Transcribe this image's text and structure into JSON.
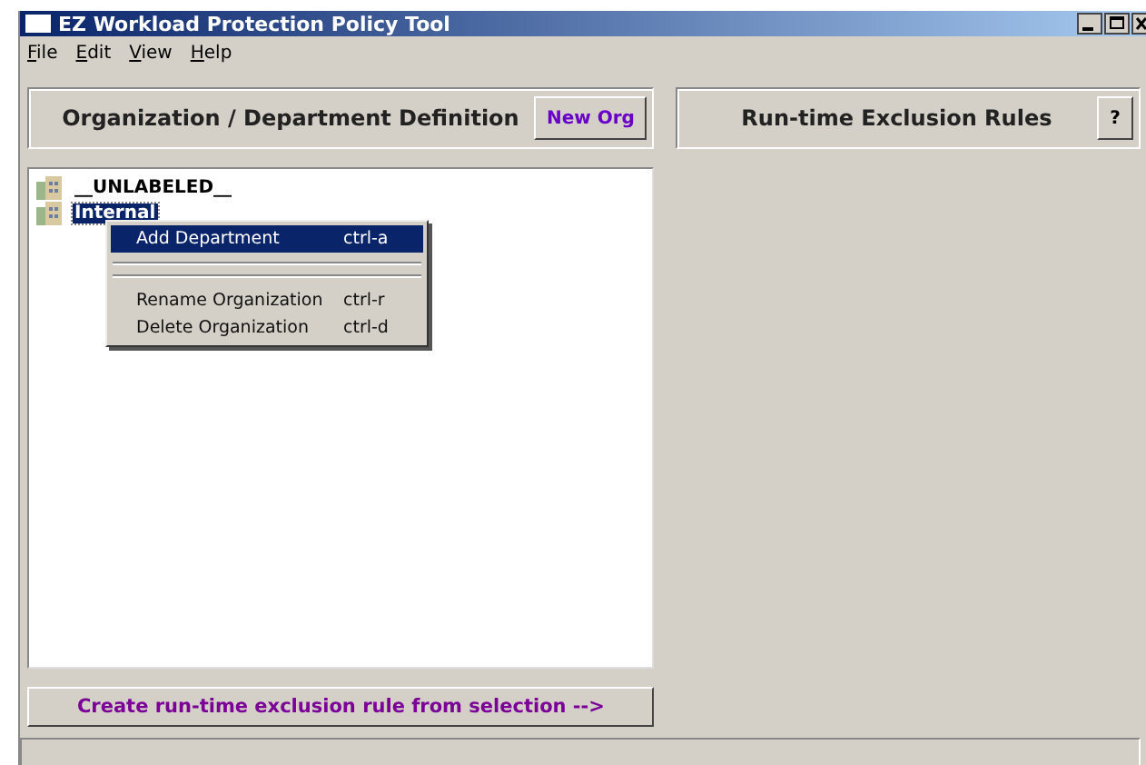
{
  "window": {
    "title": "EZ Workload Protection Policy Tool"
  },
  "menu_bar": [
    "File",
    "Edit",
    "View",
    "Help"
  ],
  "left_header": {
    "title": "Organization / Department Definition",
    "button": "New Org"
  },
  "right_header": {
    "title": "Run-time Exclusion Rules",
    "button": "?"
  },
  "tree": [
    {
      "label": "__UNLABELED__",
      "selected": false
    },
    {
      "label": "Internal",
      "selected": true
    }
  ],
  "context_menu": [
    {
      "kind": "item",
      "label": "Add Department",
      "shortcut": "ctrl-a",
      "selected": true
    },
    {
      "kind": "separator"
    },
    {
      "kind": "separator"
    },
    {
      "kind": "item",
      "label": "Rename Organization",
      "shortcut": "ctrl-r",
      "selected": false
    },
    {
      "kind": "item",
      "label": "Delete Organization",
      "shortcut": "ctrl-d",
      "selected": false
    }
  ],
  "bottom_button": "Create run-time exclusion rule from selection -->"
}
